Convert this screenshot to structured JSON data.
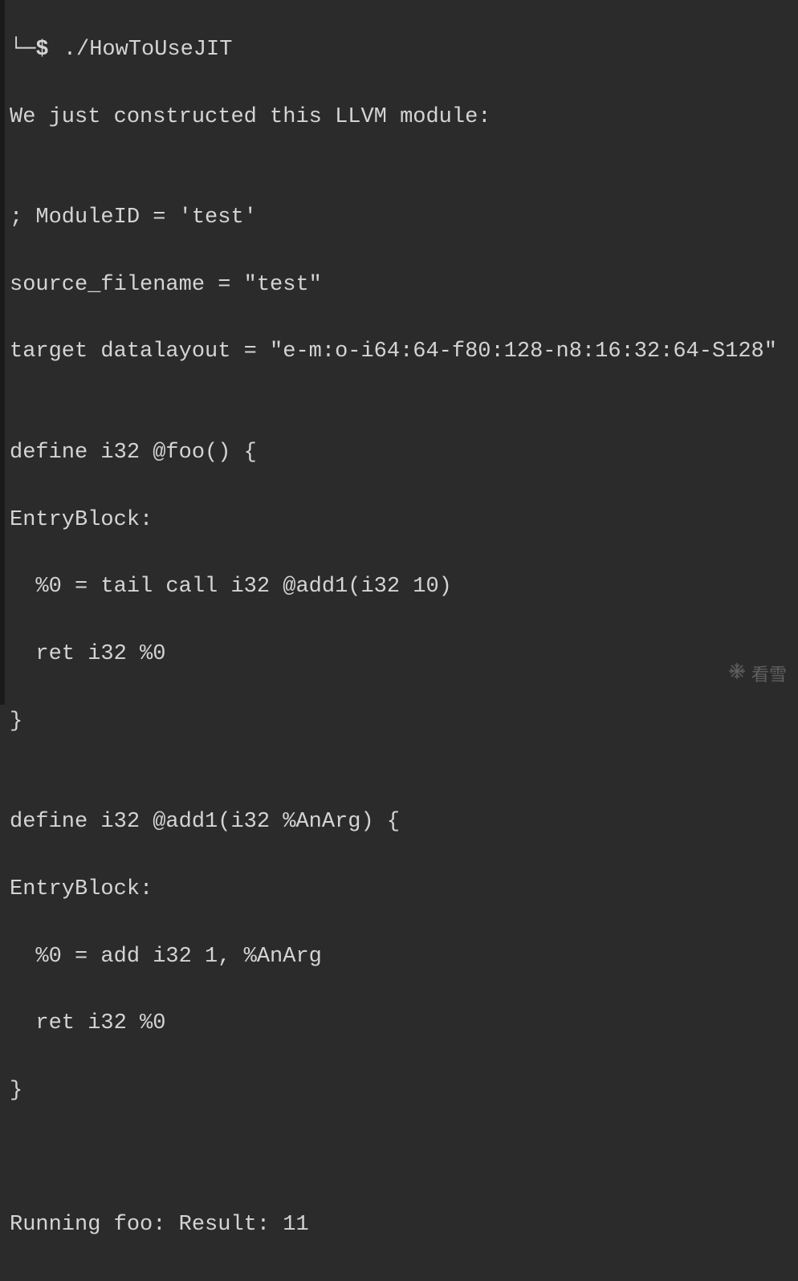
{
  "terminal": {
    "prompt_symbol": "└─$ ",
    "command": "./HowToUseJIT",
    "lines": [
      "We just constructed this LLVM module:",
      "",
      "; ModuleID = 'test'",
      "source_filename = \"test\"",
      "target datalayout = \"e-m:o-i64:64-f80:128-n8:16:32:64-S128\"",
      "",
      "define i32 @foo() {",
      "EntryBlock:",
      "  %0 = tail call i32 @add1(i32 10)",
      "  ret i32 %0",
      "}",
      "",
      "define i32 @add1(i32 %AnArg) {",
      "EntryBlock:",
      "  %0 = add i32 1, %AnArg",
      "  ret i32 %0",
      "}",
      "",
      "",
      "Running foo: Result: 11"
    ]
  },
  "watermark": {
    "text": "看雪"
  }
}
